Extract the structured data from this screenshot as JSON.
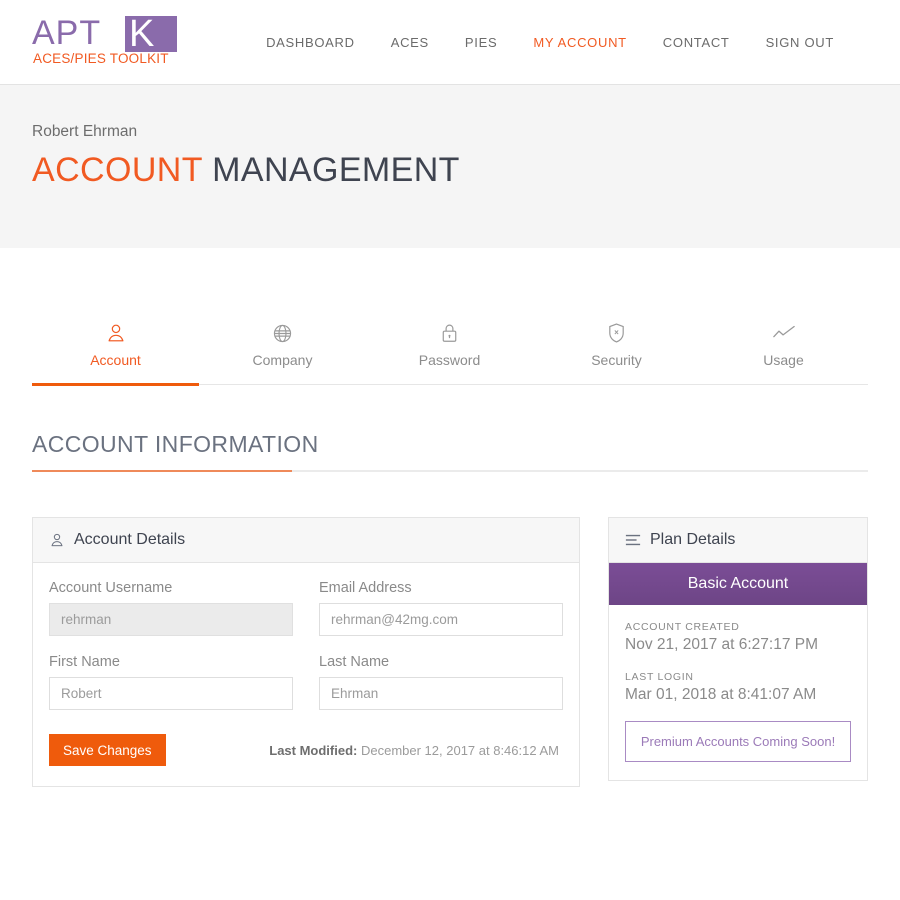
{
  "brand": {
    "logo_main": "APT",
    "logo_k": "K",
    "logo_sub": "ACES/PIES TOOLKIT",
    "purple": "#8a6bab",
    "orange": "#f15a22"
  },
  "nav": {
    "items": [
      {
        "label": "DASHBOARD",
        "active": false
      },
      {
        "label": "ACES",
        "active": false
      },
      {
        "label": "PIES",
        "active": false
      },
      {
        "label": "MY ACCOUNT",
        "active": true
      },
      {
        "label": "CONTACT",
        "active": false
      },
      {
        "label": "SIGN OUT",
        "active": false
      }
    ]
  },
  "hero": {
    "user_name": "Robert Ehrman",
    "title_accent": "ACCOUNT",
    "title_rest": " MANAGEMENT"
  },
  "tabs": [
    {
      "label": "Account",
      "icon": "user-icon",
      "active": true
    },
    {
      "label": "Company",
      "icon": "globe-icon",
      "active": false
    },
    {
      "label": "Password",
      "icon": "lock-icon",
      "active": false
    },
    {
      "label": "Security",
      "icon": "shield-icon",
      "active": false
    },
    {
      "label": "Usage",
      "icon": "chart-line-icon",
      "active": false
    }
  ],
  "section": {
    "heading": "ACCOUNT INFORMATION"
  },
  "account_details": {
    "card_title": "Account Details",
    "card_icon": "user-icon",
    "fields": [
      {
        "label": "Account Username",
        "value": "rehrman",
        "disabled": true
      },
      {
        "label": "Email Address",
        "value": "rehrman@42mg.com",
        "disabled": false
      },
      {
        "label": "First Name",
        "value": "Robert",
        "disabled": false
      },
      {
        "label": "Last Name",
        "value": "Ehrman",
        "disabled": false
      }
    ],
    "save_label": "Save Changes",
    "last_modified_label": "Last Modified:",
    "last_modified_value": " December 12, 2017 at 8:46:12 AM"
  },
  "plan_details": {
    "card_title": "Plan Details",
    "card_icon": "list-icon",
    "plan_name": "Basic Account",
    "plan_color": "#6d4586",
    "account_created_label": "ACCOUNT CREATED",
    "account_created_value": "Nov 21, 2017 at 6:27:17 PM",
    "last_login_label": "LAST LOGIN",
    "last_login_value": "Mar 01, 2018 at 8:41:07 AM",
    "cta_label": "Premium Accounts Coming Soon!"
  }
}
